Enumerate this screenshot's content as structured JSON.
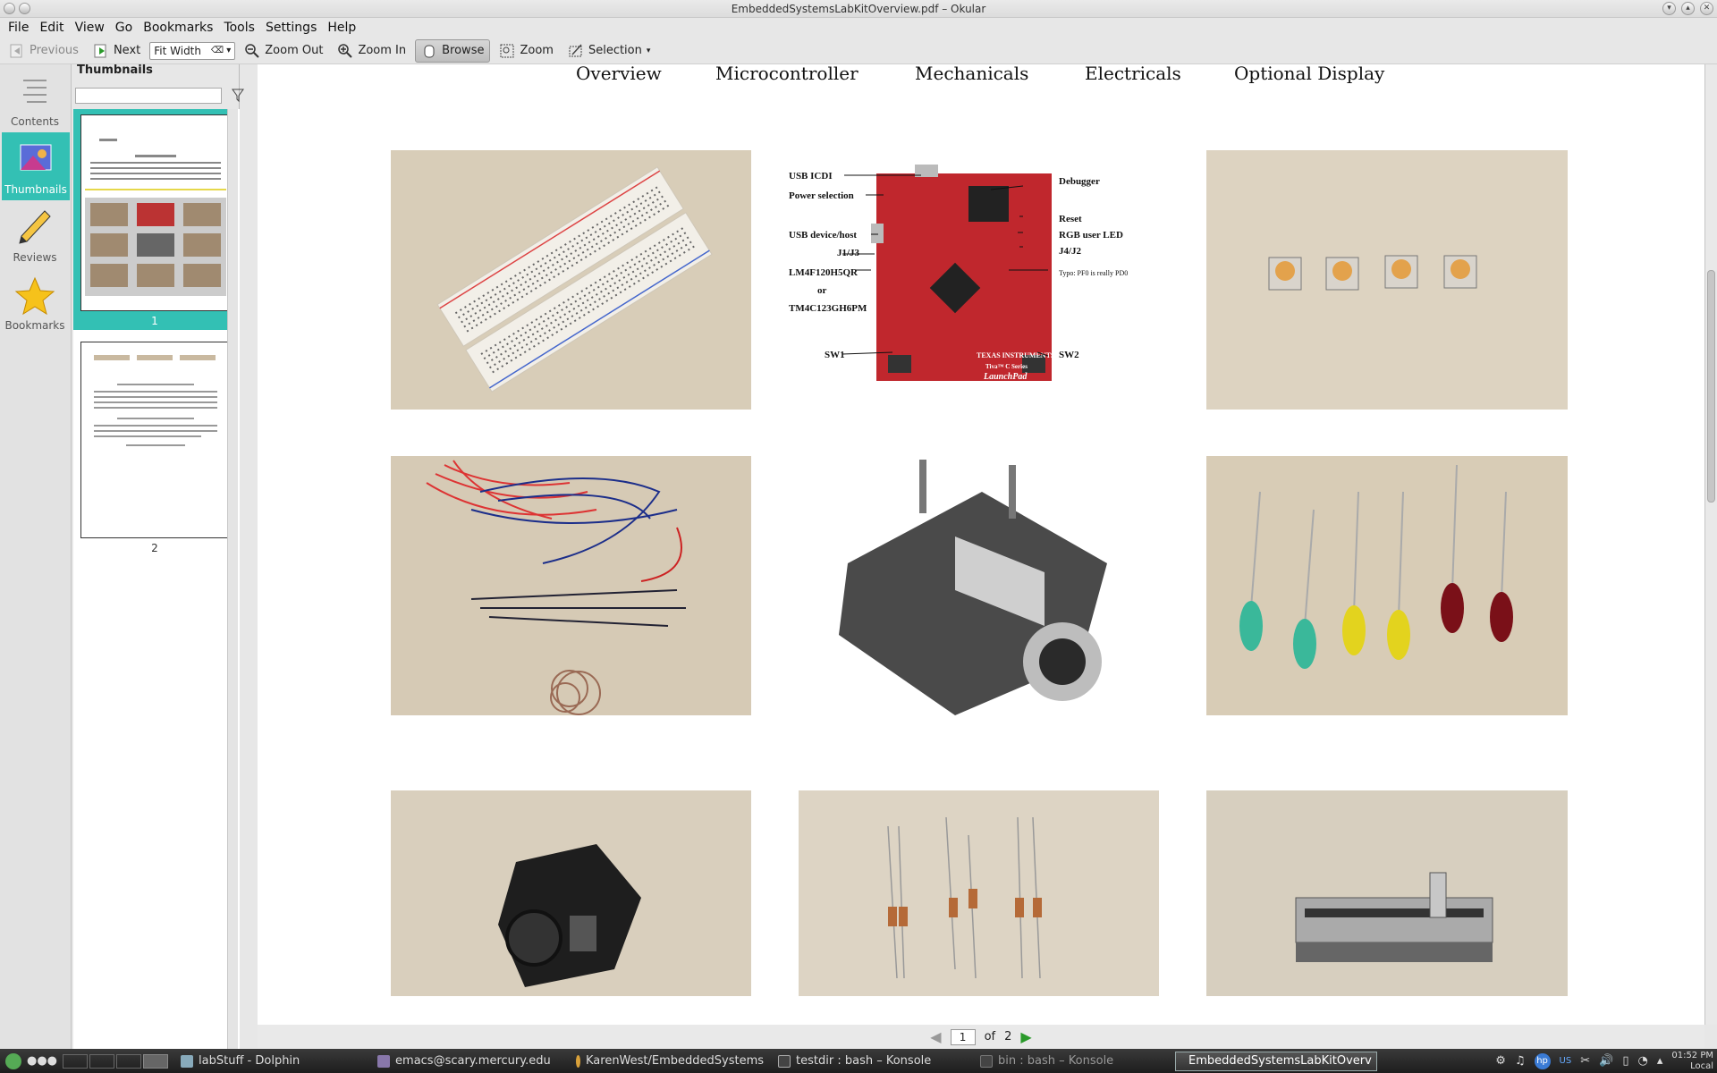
{
  "window": {
    "title": "EmbeddedSystemsLabKitOverview.pdf – Okular"
  },
  "menu": [
    "File",
    "Edit",
    "View",
    "Go",
    "Bookmarks",
    "Tools",
    "Settings",
    "Help"
  ],
  "toolbar": {
    "previous": "Previous",
    "next": "Next",
    "zoom_value": "Fit Width",
    "zoom_out": "Zoom Out",
    "zoom_in": "Zoom In",
    "browse": "Browse",
    "zoom": "Zoom",
    "selection": "Selection"
  },
  "sidebar": {
    "items": [
      {
        "label": "Contents",
        "icon": "contents-icon"
      },
      {
        "label": "Thumbnails",
        "icon": "thumbnails-icon"
      },
      {
        "label": "Reviews",
        "icon": "pencil-icon"
      },
      {
        "label": "Bookmarks",
        "icon": "star-icon"
      }
    ],
    "selected": "Thumbnails"
  },
  "thumbnails": {
    "title": "Thumbnails",
    "search_placeholder": "",
    "pages": [
      {
        "number": "1"
      },
      {
        "number": "2"
      }
    ],
    "selected_page": "1"
  },
  "document": {
    "nav_links": [
      "Overview",
      "Microcontroller",
      "Mechanicals",
      "Electricals",
      "Optional Display"
    ],
    "launchpad_labels": {
      "usb_icdi": "USB ICDI",
      "power_selection": "Power selection",
      "usb_device_host": "USB device/host",
      "j1j3": "J1/J3",
      "lm4f": "LM4F120H5QR",
      "or": "or",
      "tm4c": "TM4C123GH6PM",
      "sw1": "SW1",
      "debugger": "Debugger",
      "reset": "Reset",
      "rgb_led": "RGB user LED",
      "j4j2": "J4/J2",
      "typo": "Typo: PF0 is really PD0",
      "sw2": "SW2",
      "board_brand": "TEXAS INSTRUMENTS",
      "board_series": "Tiva™ C Series",
      "board_name": "LaunchPad"
    }
  },
  "pagebar": {
    "current": "1",
    "of": "of",
    "total": "2"
  },
  "taskbar": {
    "tasks": [
      {
        "label": "labStuff - Dolphin"
      },
      {
        "label": "emacs@scary.mercury.edu"
      },
      {
        "label": "KarenWest/EmbeddedSystems"
      },
      {
        "label": "testdir : bash – Konsole"
      },
      {
        "label": "bin : bash – Konsole"
      },
      {
        "label": "EmbeddedSystemsLabKitOverv"
      }
    ],
    "keyboard": "US",
    "time": "01:52 PM",
    "timezone": "Local"
  },
  "colors": {
    "selection_accent": "#33c0b4",
    "board_red": "#c0272d"
  }
}
